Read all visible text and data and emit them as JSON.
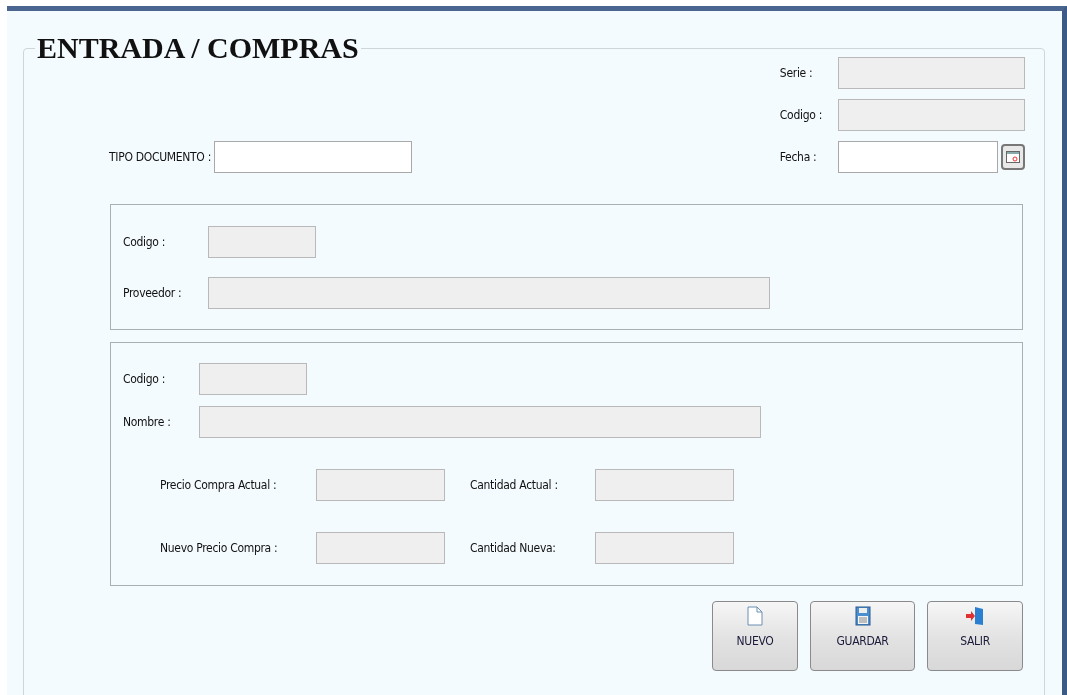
{
  "title": "ENTRADA / COMPRAS",
  "header_fields": [
    {
      "label": "Serie :",
      "kind": "text",
      "disabled": true
    },
    {
      "label": "Codigo :",
      "kind": "text",
      "disabled": true
    },
    {
      "label": "Fecha :",
      "kind": "date",
      "disabled": false
    }
  ],
  "tipo_documento": {
    "label": "TIPO DOCUMENTO :",
    "disabled": false
  },
  "proveedor_group": [
    {
      "label": "Codigo :",
      "kind": "short",
      "disabled": true
    },
    {
      "label": "Proveedor :",
      "kind": "long",
      "disabled": true
    }
  ],
  "producto_group": {
    "fields": [
      {
        "label": "Codigo :",
        "kind": "short",
        "disabled": true
      },
      {
        "label": "Nombre :",
        "kind": "long",
        "disabled": true
      }
    ],
    "price_rows": [
      [
        {
          "label": "Precio Compra Actual :",
          "disabled": true
        },
        {
          "label": "Cantidad Actual :",
          "disabled": true
        }
      ],
      [
        {
          "label": "Nuevo Precio Compra :",
          "disabled": true
        },
        {
          "label": "Cantidad Nueva:",
          "disabled": true
        }
      ]
    ]
  },
  "buttons": [
    {
      "label": "NUEVO",
      "kind": "new"
    },
    {
      "label": "GUARDAR",
      "kind": "save"
    },
    {
      "label": "SALIR",
      "kind": "exit"
    }
  ]
}
